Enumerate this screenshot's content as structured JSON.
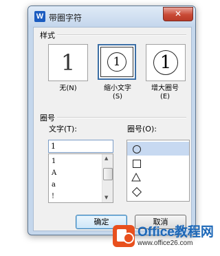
{
  "window": {
    "title": "带圈字符",
    "app_icon_letter": "W",
    "close_symbol": "✕"
  },
  "style_section": {
    "label": "样式",
    "options": [
      {
        "preview": "1",
        "label": "无(N)"
      },
      {
        "preview": "1",
        "label_line1": "缩小文字",
        "label_line2": "(S)",
        "selected": true
      },
      {
        "preview": "1",
        "label_line1": "增大圈号",
        "label_line2": "(E)"
      }
    ]
  },
  "enclosure_section": {
    "label": "圈号",
    "text_label": "文字(T):",
    "text_value": "1",
    "char_list": [
      "1",
      "A",
      "a",
      "!"
    ],
    "shape_label": "圈号(O):",
    "shapes": [
      "circle",
      "square",
      "triangle",
      "diamond"
    ]
  },
  "buttons": {
    "ok": "确定",
    "cancel": "取消"
  },
  "watermark": {
    "main": "Office教程网",
    "sub": "www.office26.com"
  }
}
